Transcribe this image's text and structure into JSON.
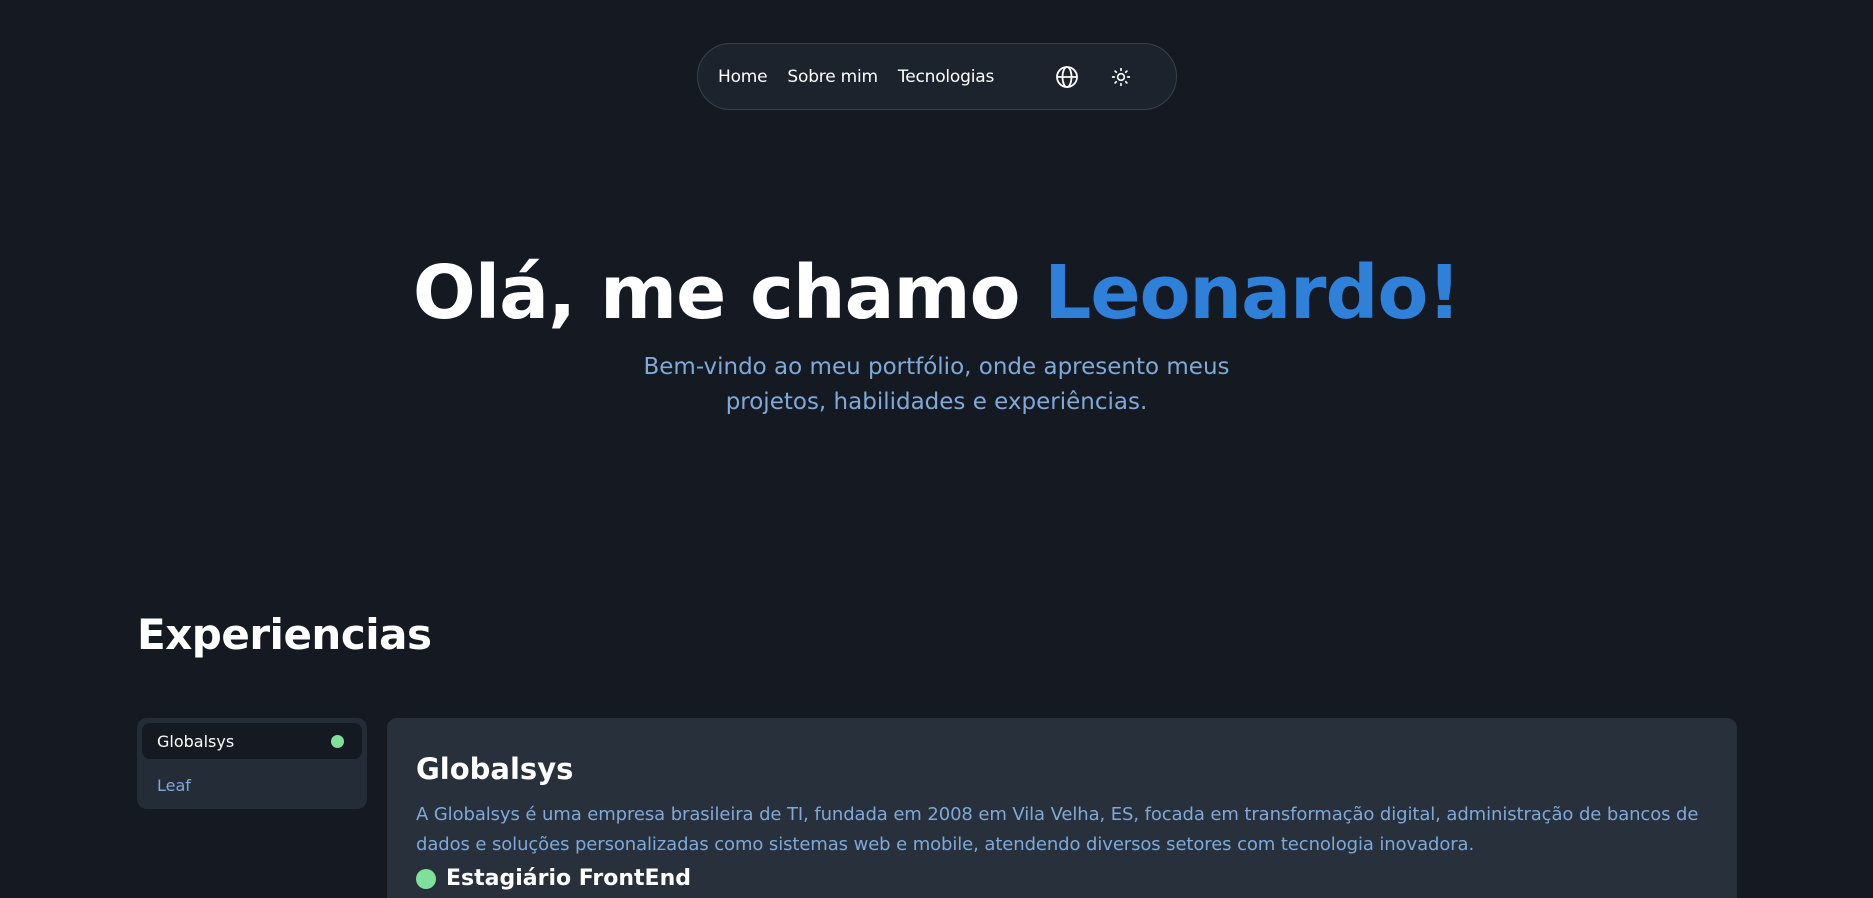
{
  "nav": {
    "links": [
      "Home",
      "Sobre mim",
      "Tecnologias"
    ],
    "language_icon": "globe-icon",
    "theme_icon": "sun-icon"
  },
  "hero": {
    "title_prefix": "Olá, me chamo ",
    "title_name": "Leonardo!",
    "subtitle": "Bem-vindo ao meu portfólio, onde apresento meus projetos, habilidades e experiências."
  },
  "experience": {
    "heading": "Experiencias",
    "tabs": [
      {
        "label": "Globalsys",
        "active": true
      },
      {
        "label": "Leaf",
        "active": false
      }
    ],
    "card": {
      "company": "Globalsys",
      "description": "A Globalsys é uma empresa brasileira de TI, fundada em 2008 em Vila Velha, ES, focada em transformação digital, administração de bancos de dados e soluções personalizadas como sistemas web e mobile, atendendo diversos setores com tecnologia inovadora.",
      "role": "Estagiário FrontEnd"
    }
  },
  "colors": {
    "background": "#151a22",
    "accent": "#2f80d9",
    "muted_text": "#7fa9d8",
    "status_green": "#7ee09a"
  }
}
